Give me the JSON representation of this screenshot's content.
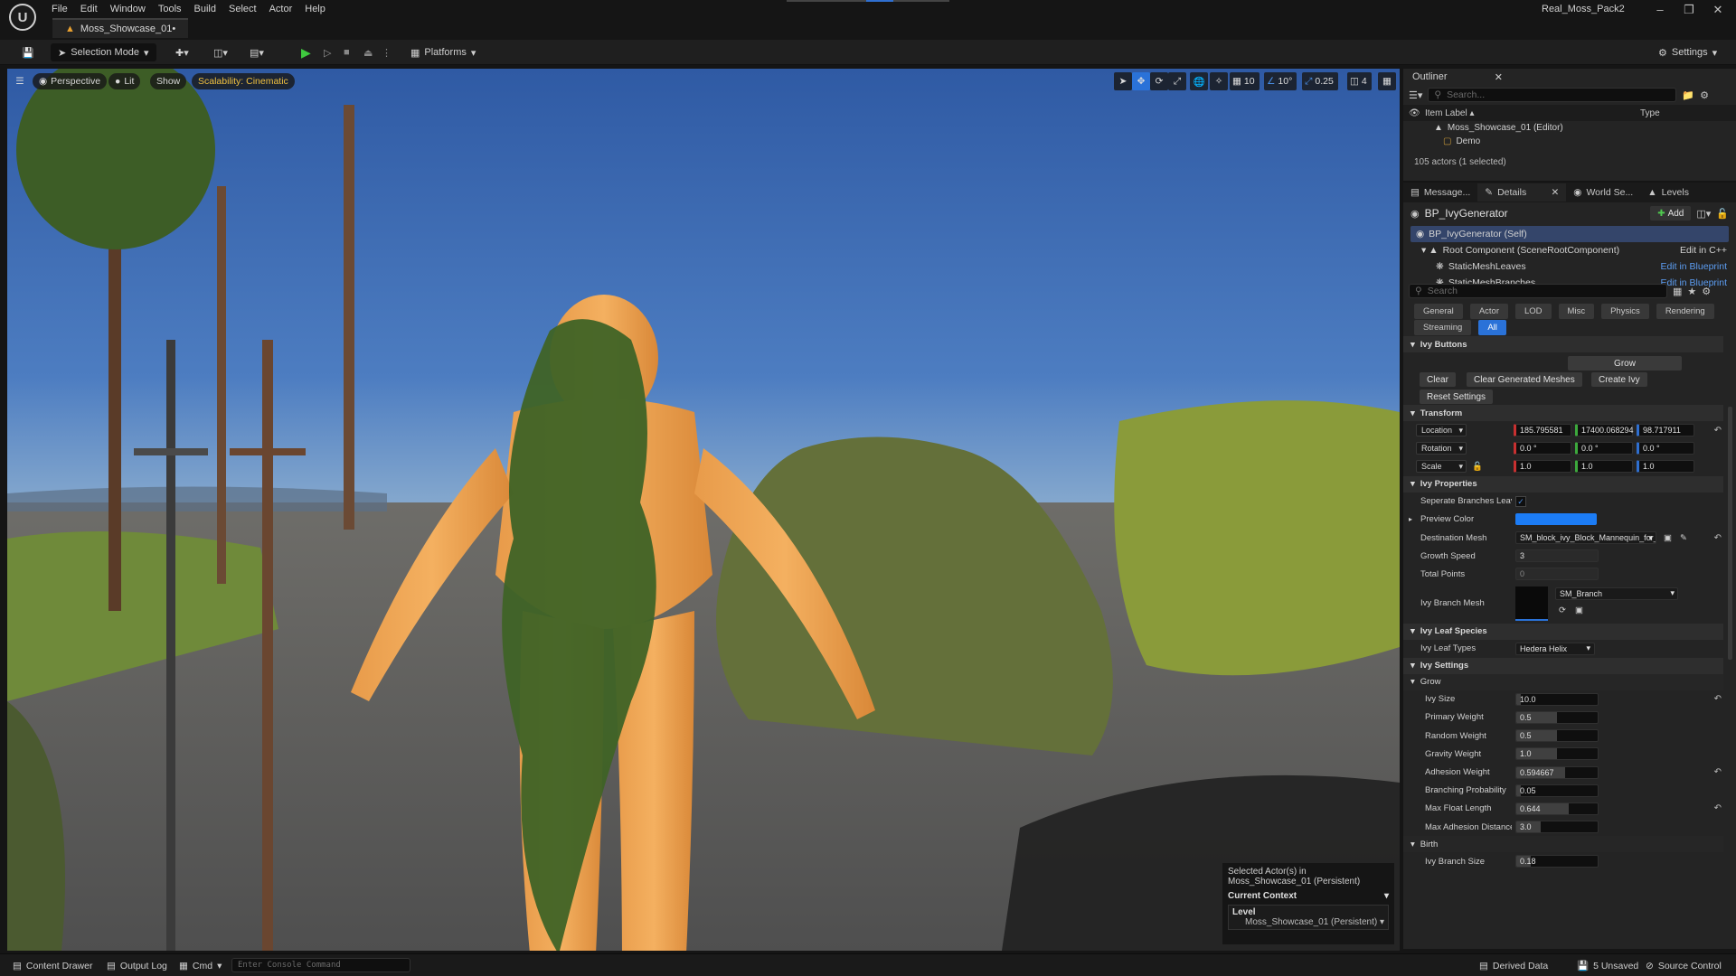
{
  "menu": [
    "File",
    "Edit",
    "Window",
    "Tools",
    "Build",
    "Select",
    "Actor",
    "Help"
  ],
  "title": {
    "level_tab": "Moss_Showcase_01•",
    "project": "Real_Moss_Pack2"
  },
  "toolbar": {
    "selection_mode": "Selection Mode",
    "platforms": "Platforms",
    "settings": "Settings"
  },
  "viewport": {
    "perspective": "Perspective",
    "lit": "Lit",
    "show": "Show",
    "scalability": "Scalability: Cinematic",
    "grid_snap": "10",
    "rot_snap": "10°",
    "scale_snap": "0.25",
    "cam_speed": "4"
  },
  "selection_info": {
    "line1": "Selected Actor(s) in",
    "line2": "Moss_Showcase_01 (Persistent)",
    "context": "Current Context",
    "level": "Level",
    "level_value": "Moss_Showcase_01 (Persistent)"
  },
  "outliner": {
    "tab": "Outliner",
    "search_placeholder": "Search...",
    "col_label": "Item Label",
    "col_type": "Type",
    "items": [
      "Moss_Showcase_01 (Editor)",
      "Demo"
    ],
    "count": "105 actors (1 selected)"
  },
  "details": {
    "tabs": [
      "Message...",
      "Details",
      "World Se...",
      "Levels"
    ],
    "actor": "BP_IvyGenerator",
    "add": "Add",
    "self": "BP_IvyGenerator (Self)",
    "components": [
      {
        "name": "Root Component (SceneRootComponent)",
        "action": "Edit in C++"
      },
      {
        "name": "StaticMeshLeaves",
        "action": "Edit in Blueprint"
      },
      {
        "name": "StaticMeshBranches",
        "action": "Edit in Blueprint"
      }
    ],
    "search_placeholder": "Search",
    "categories": [
      "General",
      "Actor",
      "LOD",
      "Misc",
      "Physics",
      "Rendering",
      "Streaming",
      "All"
    ],
    "sections": {
      "ivy_buttons": "Ivy Buttons",
      "transform": "Transform",
      "ivy_properties": "Ivy Properties",
      "leaf_species": "Ivy Leaf Species",
      "ivy_settings": "Ivy Settings",
      "grow": "Grow",
      "birth": "Birth"
    },
    "buttons": {
      "grow": "Grow",
      "clear": "Clear",
      "clear_meshes": "Clear Generated Meshes",
      "create": "Create Ivy",
      "reset": "Reset Settings"
    },
    "transform": {
      "location": {
        "label": "Location",
        "values": [
          "185.795581",
          "17400.068294",
          "98.717911"
        ]
      },
      "rotation": {
        "label": "Rotation",
        "values": [
          "0.0 °",
          "0.0 °",
          "0.0 °"
        ]
      },
      "scale": {
        "label": "Scale",
        "values": [
          "1.0",
          "1.0",
          "1.0"
        ]
      }
    },
    "props": {
      "separate_label": "Seperate Branches Leav...",
      "preview_color_label": "Preview Color",
      "preview_color": "#1c7cf5",
      "dest_mesh_label": "Destination Mesh",
      "dest_mesh": "SM_block_ivy_Block_Mannequin_for_...",
      "growth_speed_label": "Growth Speed",
      "growth_speed": "3",
      "total_points_label": "Total Points",
      "total_points": "0",
      "branch_mesh_label": "Ivy Branch Mesh",
      "branch_mesh": "SM_Branch",
      "leaf_types_label": "Ivy Leaf Types",
      "leaf_types": "Hedera Helix"
    },
    "grow_rows": [
      {
        "label": "Ivy Size",
        "value": "10.0",
        "fill": 0.05,
        "reset": true
      },
      {
        "label": "Primary Weight",
        "value": "0.5",
        "fill": 0.5,
        "reset": false
      },
      {
        "label": "Random Weight",
        "value": "0.5",
        "fill": 0.5,
        "reset": false
      },
      {
        "label": "Gravity Weight",
        "value": "1.0",
        "fill": 0.5,
        "reset": false
      },
      {
        "label": "Adhesion Weight",
        "value": "0.594667",
        "fill": 0.6,
        "reset": true
      },
      {
        "label": "Branching Probability",
        "value": "0.05",
        "fill": 0.05,
        "reset": false
      },
      {
        "label": "Max Float Length",
        "value": "0.644",
        "fill": 0.64,
        "reset": true
      },
      {
        "label": "Max Adhesion Distance",
        "value": "3.0",
        "fill": 0.3,
        "reset": false
      }
    ],
    "birth_rows": [
      {
        "label": "Ivy Branch Size",
        "value": "0.18",
        "fill": 0.18
      }
    ]
  },
  "statusbar": {
    "content_drawer": "Content Drawer",
    "output_log": "Output Log",
    "cmd": "Cmd",
    "console_placeholder": "Enter Console Command",
    "derived": "Derived Data",
    "unsaved": "5 Unsaved",
    "source": "Source Control"
  }
}
